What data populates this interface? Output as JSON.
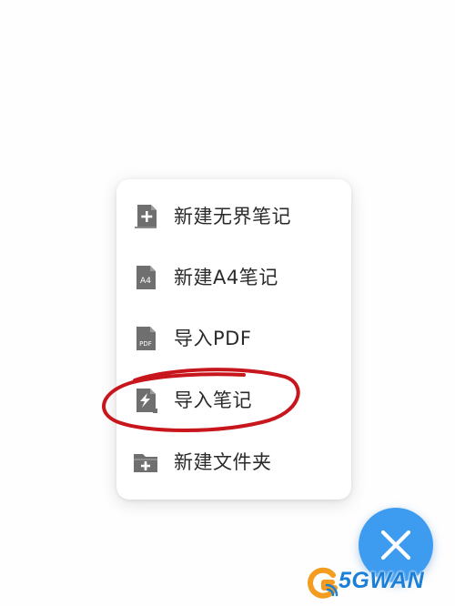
{
  "menu": {
    "items": [
      {
        "label": "新建无界笔记",
        "icon": "new-infinite-note-icon"
      },
      {
        "label": "新建A4笔记",
        "icon": "a4-note-icon",
        "icon_text": "A4"
      },
      {
        "label": "导入PDF",
        "icon": "pdf-file-icon",
        "icon_text": "PDF"
      },
      {
        "label": "导入笔记",
        "icon": "import-note-icon"
      },
      {
        "label": "新建文件夹",
        "icon": "new-folder-icon"
      }
    ]
  },
  "fab": {
    "icon": "close-icon",
    "color": "#3d9bf0"
  },
  "annotation": {
    "color": "#c8161d"
  },
  "watermark": {
    "text": "5GWAN"
  }
}
